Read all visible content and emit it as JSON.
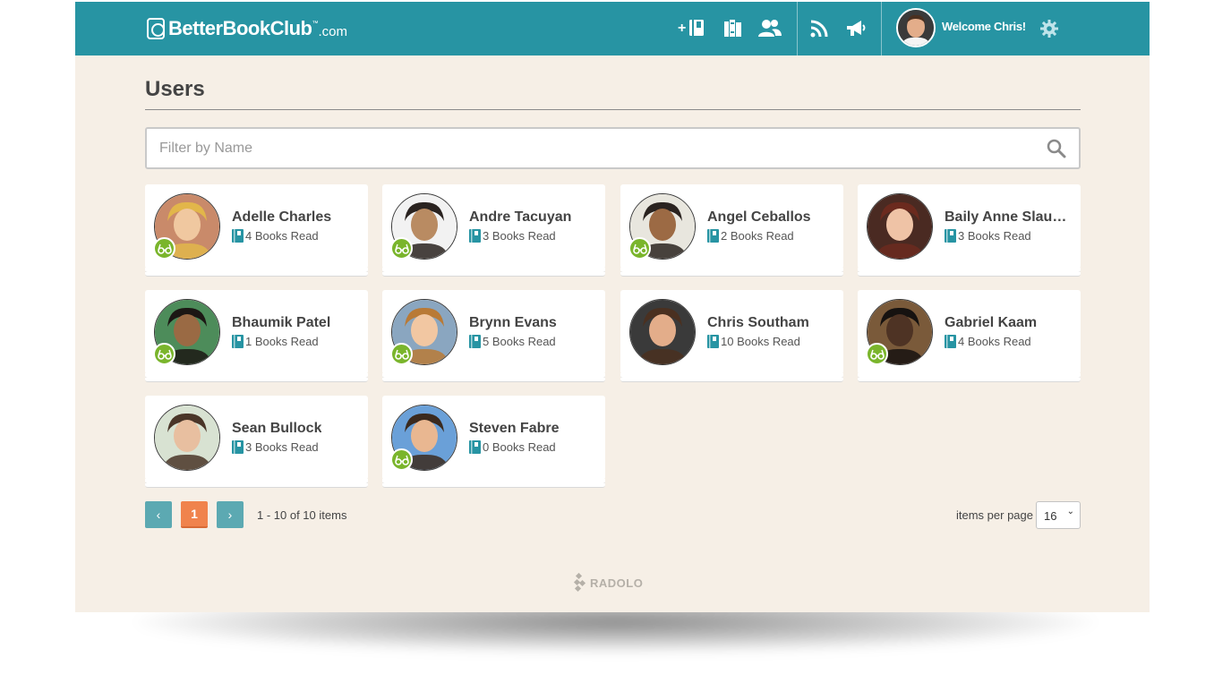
{
  "header": {
    "logo_name": "BetterBookClub",
    "logo_tm": "™",
    "logo_tld": ".com",
    "welcome": "Welcome Chris!",
    "icons": [
      "add-book-icon",
      "library-icon",
      "users-icon",
      "rss-icon",
      "megaphone-icon",
      "gear-icon"
    ],
    "accent": "#2794a3"
  },
  "page": {
    "title": "Users",
    "filter_placeholder": "Filter by Name"
  },
  "users": [
    {
      "name": "Adelle Charles",
      "books": "4 Books Read",
      "badge": true,
      "skin": "#f0c8a0",
      "hair": "#e2b64a",
      "bg": "#c98a6a"
    },
    {
      "name": "Andre Tacuyan",
      "books": "3 Books Read",
      "badge": true,
      "skin": "#b98b62",
      "hair": "#2a2320",
      "bg": "#f2f2f2"
    },
    {
      "name": "Angel Ceballos",
      "books": "2 Books Read",
      "badge": true,
      "skin": "#9c6a44",
      "hair": "#2a2320",
      "bg": "#e8e6de"
    },
    {
      "name": "Baily Anne Slaughter",
      "books": "3 Books Read",
      "badge": false,
      "skin": "#efc3a6",
      "hair": "#6b2a1e",
      "bg": "#4a2a22"
    },
    {
      "name": "Bhaumik Patel",
      "books": "1 Books Read",
      "badge": true,
      "skin": "#9a6a44",
      "hair": "#1c1714",
      "bg": "#4d8c5a"
    },
    {
      "name": "Brynn Evans",
      "books": "5 Books Read",
      "badge": true,
      "skin": "#f2c7a2",
      "hair": "#b97a36",
      "bg": "#8aa6c0"
    },
    {
      "name": "Chris Southam",
      "books": "10 Books Read",
      "badge": false,
      "skin": "#e3ad8a",
      "hair": "#4a3020",
      "bg": "#3a3a3a"
    },
    {
      "name": "Gabriel Kaam",
      "books": "4 Books Read",
      "badge": true,
      "skin": "#4e3324",
      "hair": "#161210",
      "bg": "#7a5a3a"
    },
    {
      "name": "Sean Bullock",
      "books": "3 Books Read",
      "badge": false,
      "skin": "#e8bfa0",
      "hair": "#4a3528",
      "bg": "#d8e2d2"
    },
    {
      "name": "Steven Fabre",
      "books": "0 Books Read",
      "badge": true,
      "skin": "#e9b791",
      "hair": "#3b2a1e",
      "bg": "#6aa0d8"
    }
  ],
  "pager": {
    "prev": "‹",
    "current": "1",
    "next": "›",
    "info": "1 - 10 of 10 items",
    "per_page_label": "items per page",
    "per_page_value": "16"
  },
  "footer": {
    "brand": "RADOLO"
  }
}
